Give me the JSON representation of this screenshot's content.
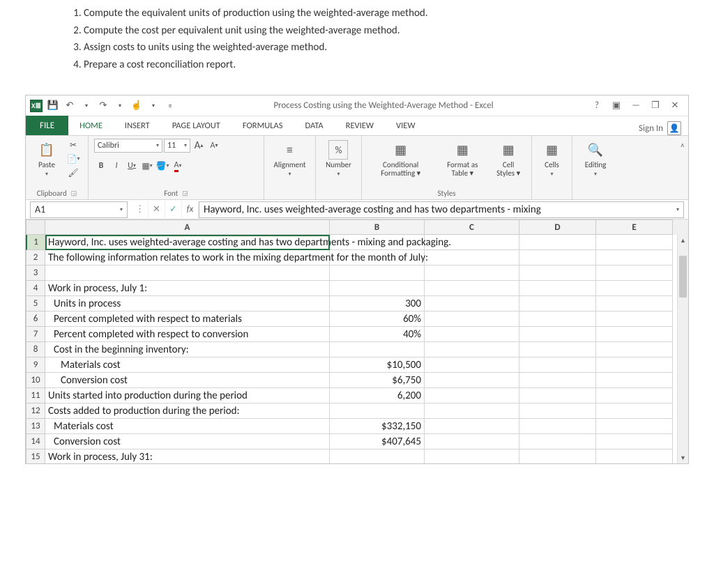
{
  "instructions": [
    "Compute the equivalent units of production using the weighted-average method.",
    "Compute the cost per equivalent unit using the weighted-average method.",
    "Assign costs to units using the weighted-average method.",
    "Prepare a cost reconciliation report."
  ],
  "titlebar": {
    "app_glyph": "X≣",
    "title": "Process Costing using the Weighted-Average Method - Excel"
  },
  "win": {
    "help": "?",
    "ribbon_opts": "▣",
    "min": "—",
    "restore": "❐",
    "close": "✕"
  },
  "tabs": {
    "file": "FILE",
    "home": "HOME",
    "insert": "INSERT",
    "page_layout": "PAGE LAYOUT",
    "formulas": "FORMULAS",
    "data": "DATA",
    "review": "REVIEW",
    "view": "VIEW",
    "signin": "Sign In"
  },
  "ribbon": {
    "clipboard": {
      "paste": "Paste",
      "label": "Clipboard"
    },
    "font": {
      "name": "Calibri",
      "size": "11",
      "grow": "A",
      "shrink": "A",
      "bold": "B",
      "italic": "I",
      "underline": "U",
      "label": "Font"
    },
    "alignment": {
      "label": "Alignment"
    },
    "number": {
      "pct": "%",
      "label": "Number"
    },
    "styles": {
      "cond": "Conditional Formatting ▾",
      "fmt": "Format as Table ▾",
      "cell": "Cell Styles ▾",
      "label": "Styles"
    },
    "cells": {
      "label": "Cells"
    },
    "editing": {
      "label": "Editing"
    }
  },
  "formula": {
    "name_box": "A1",
    "fx": "fx",
    "content": "Hayword, Inc. uses weighted-average costing and has two departments - mixing"
  },
  "columns": [
    "A",
    "B",
    "C",
    "D",
    "E"
  ],
  "rows": [
    {
      "n": 1,
      "a": "Hayword, Inc. uses weighted-average costing and has two departments - mixing and packaging.",
      "full": true
    },
    {
      "n": 2,
      "a": "The following information relates to work in the mixing department for the month of July:",
      "full": true
    },
    {
      "n": 3,
      "a": ""
    },
    {
      "n": 4,
      "a": "Work in process, July 1:"
    },
    {
      "n": 5,
      "a": "Units in process",
      "b": "300",
      "indent": 1
    },
    {
      "n": 6,
      "a": "Percent completed with respect to materials",
      "b": "60%",
      "indent": 1
    },
    {
      "n": 7,
      "a": "Percent completed with respect to conversion",
      "b": "40%",
      "indent": 1
    },
    {
      "n": 8,
      "a": "Cost in the beginning inventory:",
      "indent": 1
    },
    {
      "n": 9,
      "a": "Materials cost",
      "b": "$10,500",
      "indent": 2
    },
    {
      "n": 10,
      "a": "Conversion cost",
      "b": "$6,750",
      "indent": 2
    },
    {
      "n": 11,
      "a": "Units started into production during the period",
      "b": "6,200"
    },
    {
      "n": 12,
      "a": "Costs added to production during the period:"
    },
    {
      "n": 13,
      "a": "Materials cost",
      "b": "$332,150",
      "indent": 1
    },
    {
      "n": 14,
      "a": "Conversion cost",
      "b": "$407,645",
      "indent": 1
    },
    {
      "n": 15,
      "a": "Work in process, July 31:"
    }
  ]
}
